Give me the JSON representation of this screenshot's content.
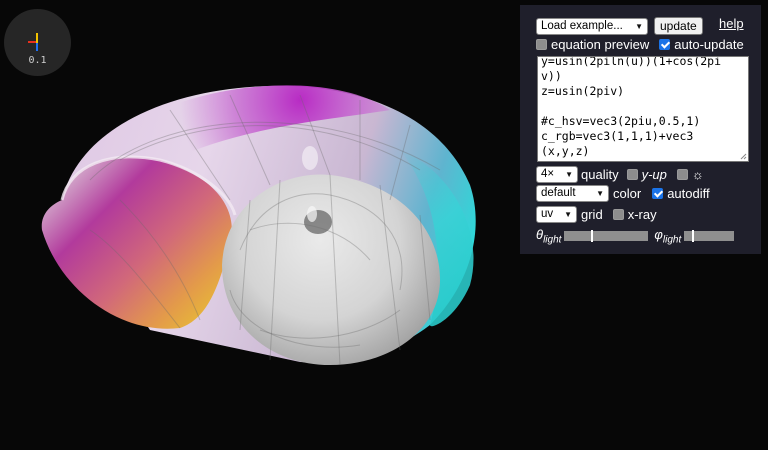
{
  "canvas": {
    "background": "#070707"
  },
  "axis_gizmo": {
    "scale_label": "0.1",
    "colors": {
      "x": "#e8301e",
      "y": "#f2c200",
      "z": "#1e6ff0"
    }
  },
  "panel": {
    "example_select": "Load example...",
    "update_label": "update",
    "help_label": "help",
    "equation_preview_label": "equation preview",
    "equation_preview_checked": false,
    "auto_update_label": "auto-update",
    "auto_update_checked": true,
    "editor_lines": [
      "y=usin(2piln(u))(1+cos(2pi",
      "v))",
      "z=usin(2piv)",
      "",
      "#c_hsv=vec3(2piu,0.5,1)",
      "c_rgb=vec3(1,1,1)+vec3",
      "(x,y,z)"
    ],
    "quality_select": "4×",
    "quality_label": "quality",
    "y_up_label": "y-up",
    "y_up_checked": false,
    "light_toggle_icon": "sun-icon",
    "light_toggle_label": "☼",
    "light_toggle_checked": false,
    "color_select": "default",
    "color_label": "color",
    "autodiff_label": "autodiff",
    "autodiff_checked": true,
    "grid_select": "uv",
    "grid_label": "grid",
    "xray_label": "x-ray",
    "xray_checked": false,
    "theta_symbol": "θ",
    "phi_symbol": "φ",
    "light_subscript": "light",
    "theta_light_value": 0.33,
    "phi_light_value": 0.17
  }
}
